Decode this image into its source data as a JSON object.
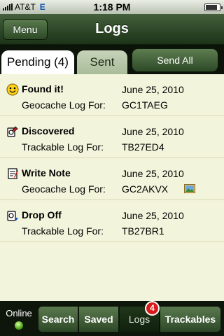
{
  "status_bar": {
    "carrier": "AT&T",
    "network": "E",
    "time": "1:18 PM"
  },
  "nav": {
    "menu_label": "Menu",
    "title": "Logs"
  },
  "tabs": {
    "pending": "Pending (4)",
    "sent": "Sent",
    "send_all": "Send All"
  },
  "logs": [
    {
      "icon": "smiley-icon",
      "name": "Found it!",
      "date": "June 25, 2010",
      "kind": "Geocache Log For:",
      "code": "GC1TAEG"
    },
    {
      "icon": "discovered-icon",
      "name": "Discovered",
      "date": "June 25, 2010",
      "kind": "Trackable Log For:",
      "code": "TB27ED4"
    },
    {
      "icon": "note-icon",
      "name": "Write Note",
      "date": "June 25, 2010",
      "kind": "Geocache Log For:",
      "code": "GC2AKVX",
      "has_photo": true
    },
    {
      "icon": "drop-off-icon",
      "name": "Drop Off",
      "date": "June 25, 2010",
      "kind": "Trackable Log For:",
      "code": "TB27BR1"
    }
  ],
  "bottom_bar": {
    "online_label": "Online",
    "search": "Search",
    "saved": "Saved",
    "logs": "Logs",
    "logs_badge": "4",
    "trackables": "Trackables"
  },
  "colors": {
    "nav_green": "#2c4a26",
    "badge_red": "#d81a1a",
    "list_bg": "#f3f4dc"
  }
}
